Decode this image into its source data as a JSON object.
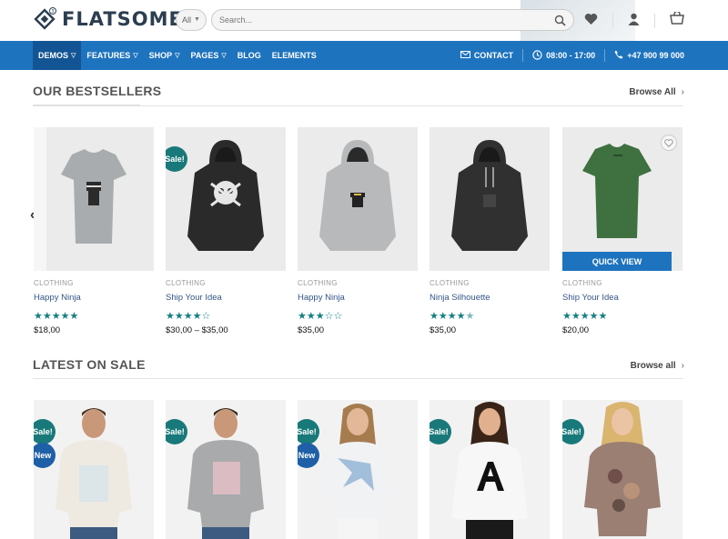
{
  "header": {
    "logo_text": "FLATSOME",
    "search_category": "All",
    "search_placeholder": "Search..."
  },
  "nav": {
    "items": [
      {
        "label": "DEMOS",
        "caret": true,
        "active": true
      },
      {
        "label": "FEATURES",
        "caret": true
      },
      {
        "label": "SHOP",
        "caret": true
      },
      {
        "label": "PAGES",
        "caret": true
      },
      {
        "label": "BLOG",
        "caret": false
      },
      {
        "label": "ELEMENTS",
        "caret": false
      }
    ],
    "contact": "CONTACT",
    "hours": "08:00 - 17:00",
    "phone": "+47 900 99 000"
  },
  "bestsellers": {
    "title": "OUR BESTSELLERS",
    "browse": "Browse All",
    "products": [
      {
        "category": "CLOTHING",
        "name": "Happy Ninja",
        "rating": 5,
        "price": "$18,00",
        "image_icon": "grey-tshirt-icon"
      },
      {
        "category": "CLOTHING",
        "name": "Ship Your Idea",
        "rating": 4,
        "price": "$30,00 – $35,00",
        "sale": "Sale!",
        "image_icon": "black-hoodie-icon"
      },
      {
        "category": "CLOTHING",
        "name": "Happy Ninja",
        "rating": 3,
        "price": "$35,00",
        "image_icon": "grey-hoodie-icon"
      },
      {
        "category": "CLOTHING",
        "name": "Ninja Silhouette",
        "rating": 4.5,
        "price": "$35,00",
        "image_icon": "black-hoodie-icon"
      },
      {
        "category": "CLOTHING",
        "name": "Ship Your Idea",
        "rating": 5,
        "price": "$20,00",
        "quick_view": "QUICK VIEW",
        "image_icon": "green-tshirt-icon"
      }
    ]
  },
  "latest": {
    "title": "LATEST ON SALE",
    "browse": "Browse all",
    "products": [
      {
        "badges": [
          "Sale!",
          "New"
        ]
      },
      {
        "badges": [
          "Sale!"
        ]
      },
      {
        "badges": [
          "Sale!",
          "New"
        ]
      },
      {
        "badges": [
          "Sale!"
        ]
      },
      {
        "badges": [
          "Sale!"
        ]
      }
    ]
  },
  "colors": {
    "nav_blue": "#1e73be",
    "nav_active": "#135594",
    "sale_badge": "#19797a",
    "new_badge": "#1e5fa8",
    "star": "#137f82"
  }
}
